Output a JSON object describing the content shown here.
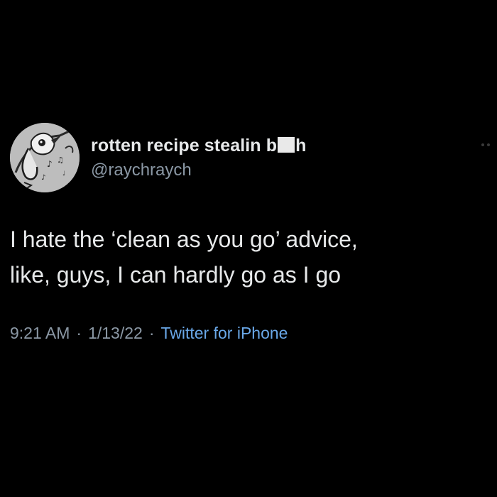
{
  "tweet": {
    "display_name": "rotten recipe stealin b",
    "display_name_tail": "h",
    "handle": "@raychraych",
    "text": "I hate the ‘clean as you go’ advice,\nlike, guys, I can hardly go as I go",
    "time": "9:21 AM",
    "separator": "·",
    "date": "1/13/22",
    "source": "Twitter for iPhone"
  },
  "icons": {
    "avatar": "bird-sketch-avatar",
    "more": "more-dots-icon",
    "censor": "censor-bar"
  },
  "colors": {
    "background": "#000000",
    "text": "#e7e9ea",
    "secondary": "#8b98a5",
    "link": "#6aa8e8"
  }
}
